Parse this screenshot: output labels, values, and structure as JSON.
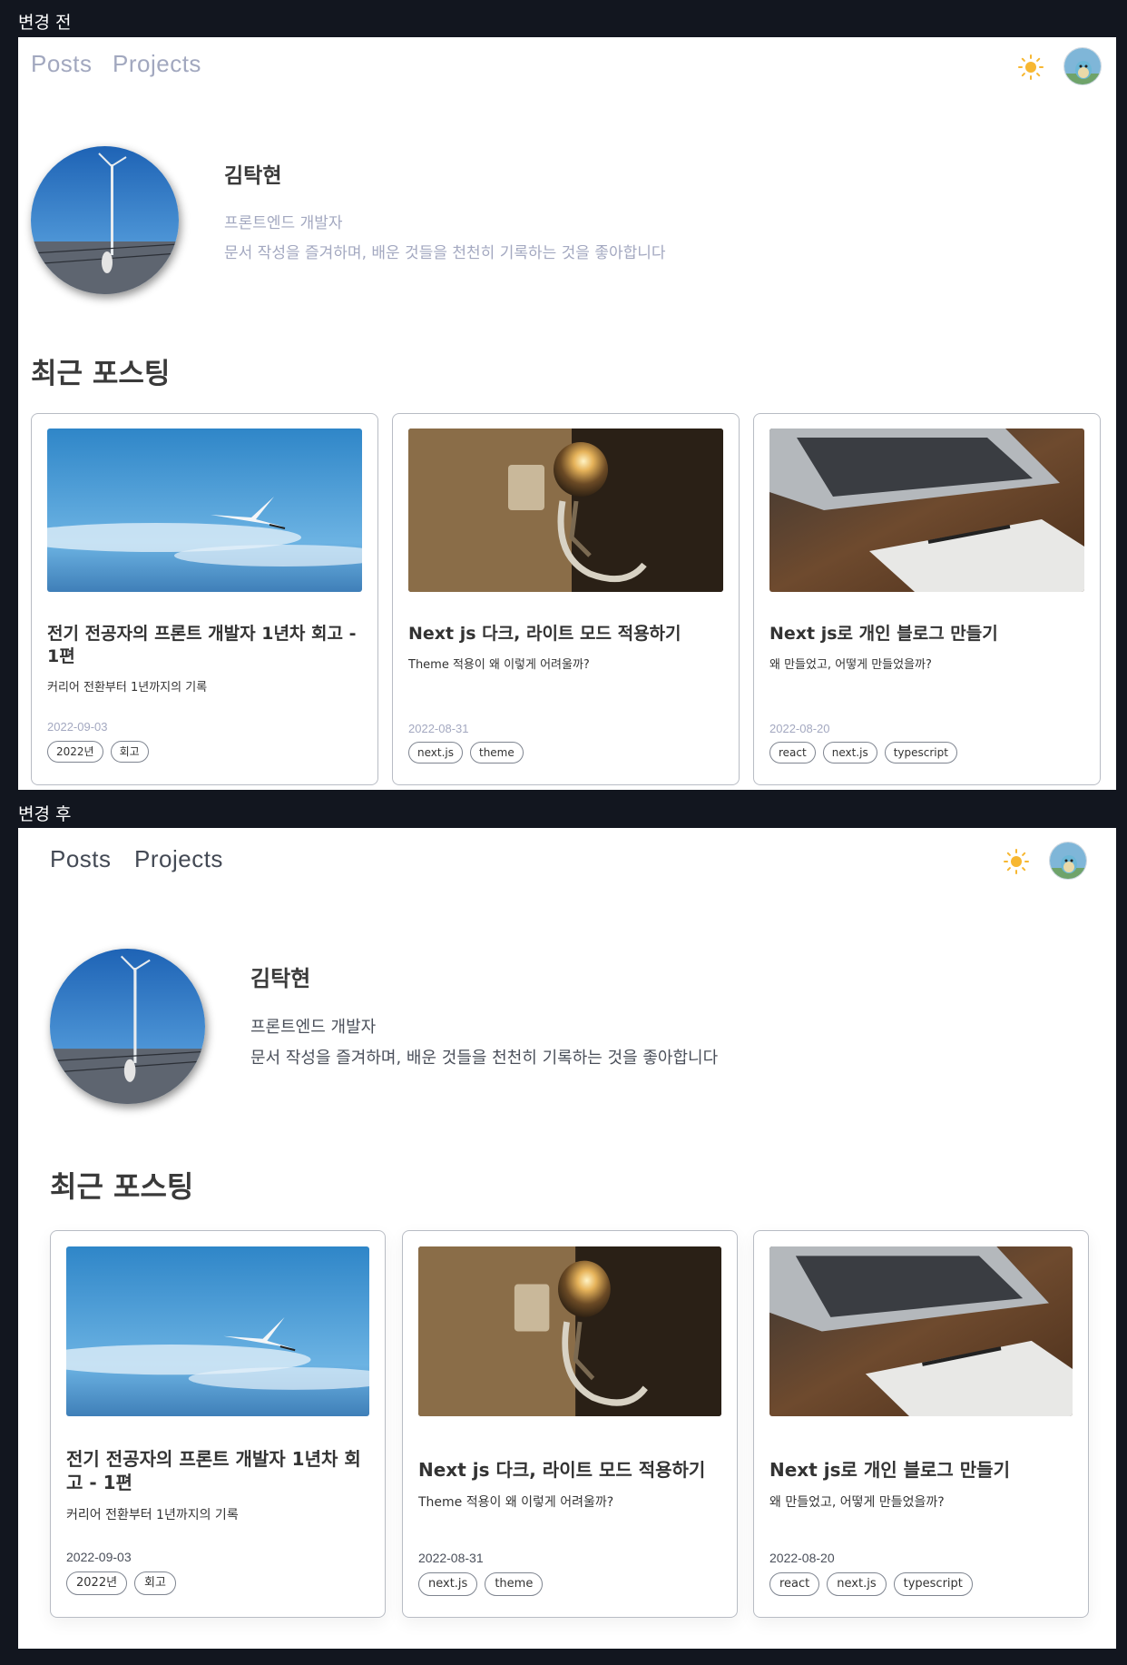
{
  "before_label": "변경 전",
  "after_label": "변경 후",
  "nav": {
    "posts": "Posts",
    "projects": "Projects"
  },
  "icons": {
    "theme_toggle": "sun-icon",
    "avatar": "avatar-icon"
  },
  "colors": {
    "sun": "#f7b731",
    "page_bg": "#12161f"
  },
  "profile": {
    "name": "김탁현",
    "role": "프론트엔드 개발자",
    "intro": "문서 작성을 즐겨하며, 배운 것들을 천천히 기록하는 것을 좋아합니다"
  },
  "recent_title": "최근 포스팅",
  "posts": [
    {
      "title": "전기 전공자의 프론트 개발자 1년차 회고 - 1편",
      "subtitle": "커리어 전환부터 1년까지의 기록",
      "date": "2022-09-03",
      "tags": [
        "2022년",
        "회고"
      ],
      "image": "bird-in-sky"
    },
    {
      "title": "Next js 다크, 라이트 모드 적용하기",
      "subtitle": "Theme 적용이 왜 이렇게 어려울까?",
      "date": "2022-08-31",
      "tags": [
        "next.js",
        "theme"
      ],
      "image": "lightbulb-figure"
    },
    {
      "title": "Next js로 개인 블로그 만들기",
      "subtitle": "왜 만들었고, 어떻게 만들었을까?",
      "date": "2022-08-20",
      "tags": [
        "react",
        "next.js",
        "typescript"
      ],
      "image": "laptop-on-desk"
    }
  ]
}
